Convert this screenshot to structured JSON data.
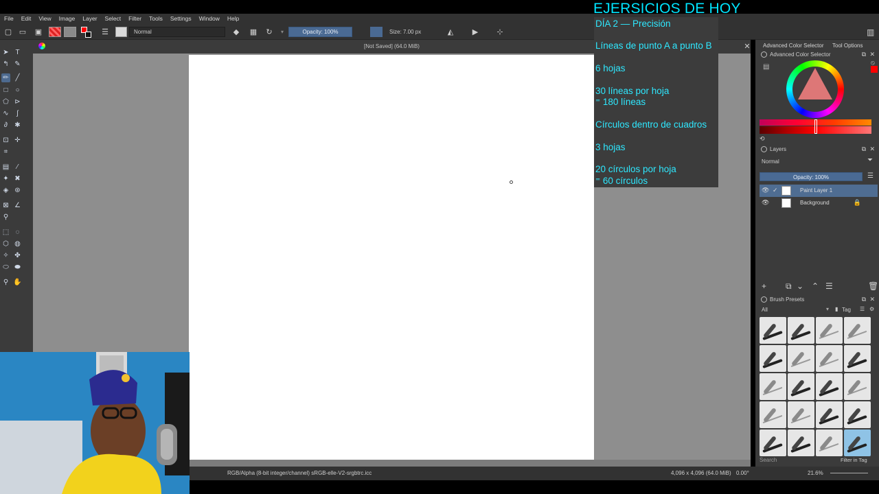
{
  "menu": [
    "File",
    "Edit",
    "View",
    "Image",
    "Layer",
    "Select",
    "Filter",
    "Tools",
    "Settings",
    "Window",
    "Help"
  ],
  "toolbar": {
    "blend_mode": "Normal",
    "opacity": "Opacity: 100%",
    "size": "Size: 7.00 px"
  },
  "document": {
    "title": "[Not Saved]  (64.0 MiB)"
  },
  "overlay": {
    "title": "EJERSICIOS DE HOY",
    "lines": [
      "DÍA 2 — Precisión",
      "Líneas de punto A a punto B",
      "6 hojas",
      "30 líneas por hoja",
      "⁼ 180 líneas",
      "Círculos dentro de cuadros",
      "3 hojas",
      "20 círculos por hoja",
      "⁼ 60 círculos"
    ]
  },
  "dock": {
    "tabs": [
      "Advanced Color Selector",
      "Tool Options"
    ],
    "color_panel_title": "Advanced Color Selector",
    "layers_panel_title": "Layers",
    "layers_blend": "Normal",
    "layers_opacity": "Opacity:  100%",
    "layers": [
      {
        "name": "Paint Layer 1",
        "selected": true
      },
      {
        "name": "Background",
        "selected": false
      }
    ],
    "presets_title": "Brush Presets",
    "presets_filter": "All",
    "presets_tag": "Tag",
    "presets_search": "Search",
    "filter_in_tag": "Filter in Tag"
  },
  "status": {
    "color_info": "RGB/Alpha (8-bit integer/channel)  sRGB-elle-V2-srgbtrc.icc",
    "image_size": "4,096 x 4,096 (64.0 MiB)",
    "rotation": "0.00°",
    "zoom": "21.6%"
  },
  "colors": {
    "accent": "#4d6a8f",
    "overlay_text": "#2ee8ff",
    "foreground": "#ff0000"
  }
}
